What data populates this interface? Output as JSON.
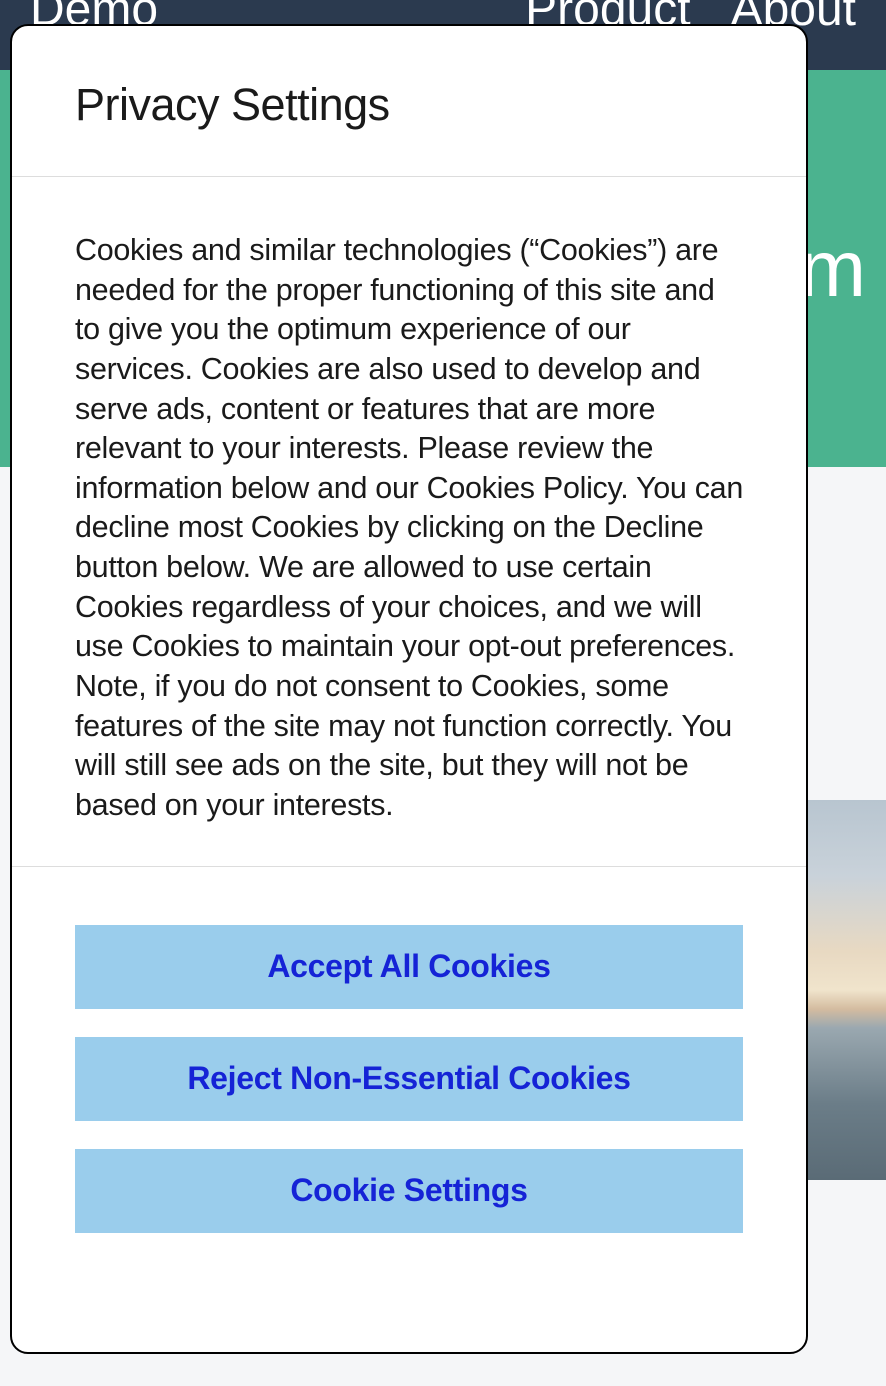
{
  "nav": {
    "brand": "Demo",
    "items": [
      "Product",
      "About"
    ]
  },
  "hero": {
    "partial_text": "m"
  },
  "modal": {
    "title": "Privacy Settings",
    "body": "Cookies and similar technologies (“Cookies”) are needed for the proper functioning of this site and to give you the optimum experience of our services. Cookies are also used to develop and serve ads, content or features that are more relevant to your interests. Please review the information below and our Cookies Policy. You can decline most Cookies by clicking on the Decline button below. We are allowed to use certain Cookies regardless of your choices, and we will use Cookies to maintain your opt-out preferences. Note, if you do not consent to Cookies, some features of the site may not function correctly. You will still see ads on the site, but they will not be based on your interests.",
    "buttons": {
      "accept": "Accept All Cookies",
      "reject": "Reject Non-Essential Cookies",
      "settings": "Cookie Settings"
    }
  }
}
